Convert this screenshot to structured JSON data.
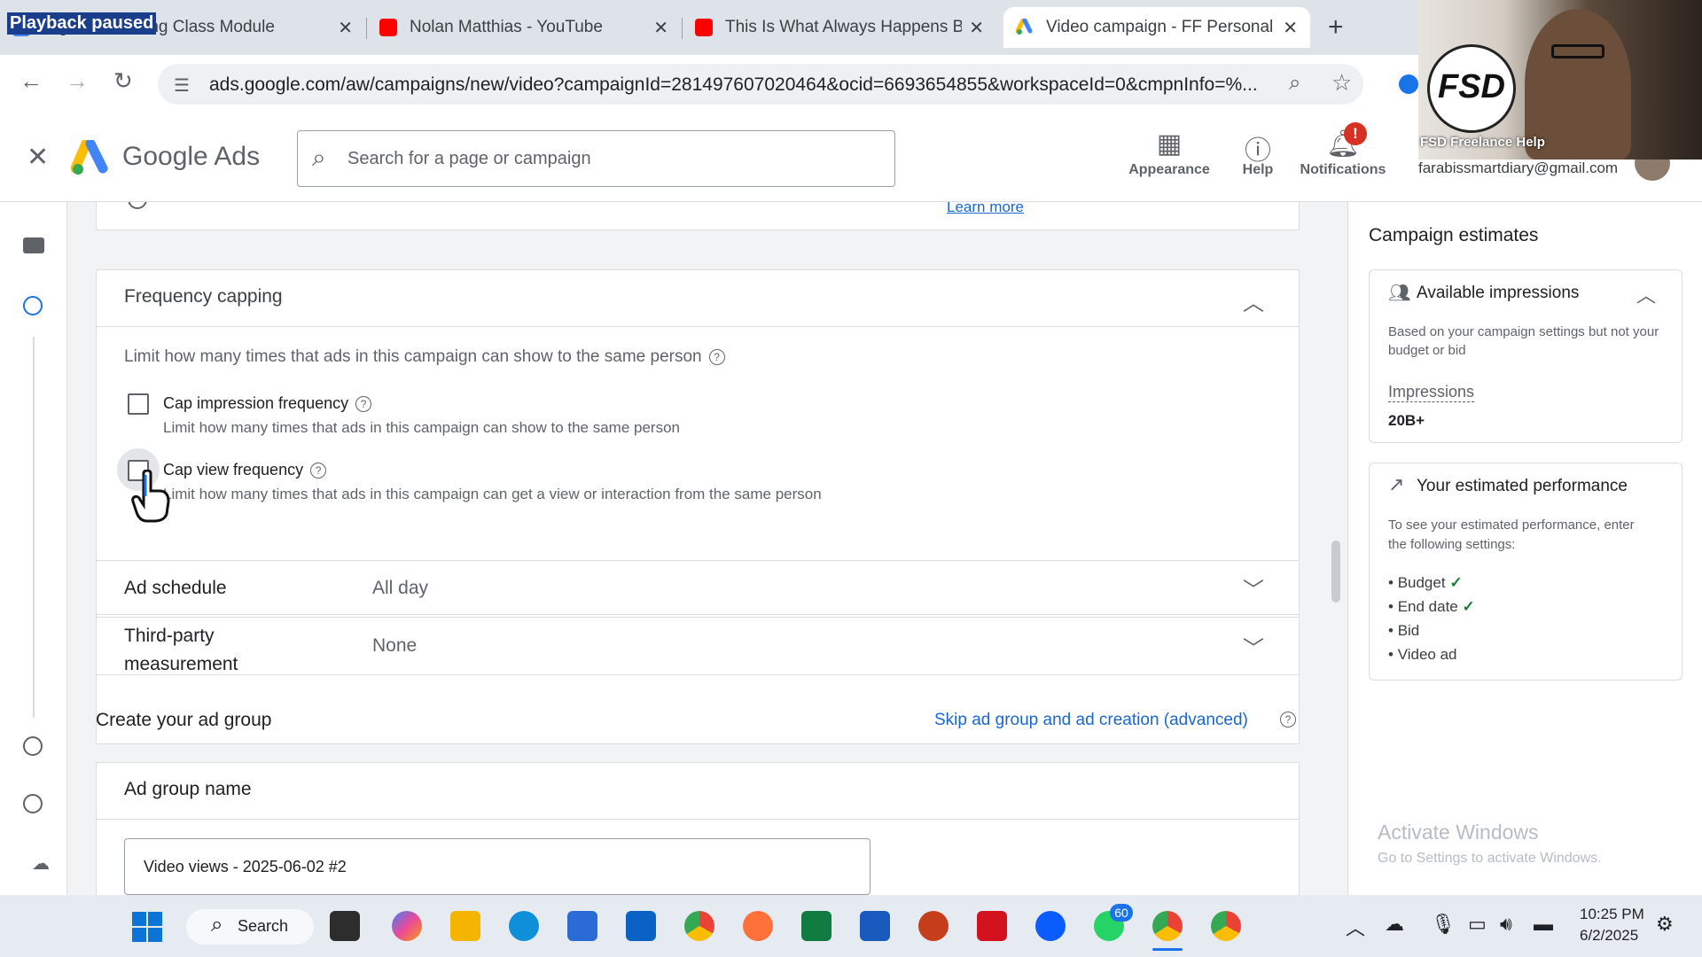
{
  "overlay": {
    "playback_text": "Playback paused"
  },
  "browser": {
    "tabs": [
      {
        "title": "Digital Marketing Class Module",
        "active": false
      },
      {
        "title": "Nolan Matthias - YouTube",
        "active": false
      },
      {
        "title": "This Is What Always Happens B",
        "active": false
      },
      {
        "title": "Video campaign - FF Personal -",
        "active": true
      }
    ],
    "url": "ads.google.com/aw/campaigns/new/video?campaignId=281497607020464&ocid=6693654855&workspaceId=0&cmpnInfo=%...",
    "new_tab": "+"
  },
  "ads_header": {
    "product": "Google Ads",
    "search_placeholder": "Search for a page or campaign",
    "appearance": "Appearance",
    "help": "Help",
    "notifications": "Notifications",
    "notification_badge": "!",
    "account": "farabissmartdiary@gmail.com"
  },
  "webcam": {
    "label": "FSD Freelance Help",
    "logo": "FSD"
  },
  "top_card": {
    "link": "Learn more"
  },
  "frequency": {
    "title": "Frequency capping",
    "description": "Limit how many times that ads in this campaign can show to the same person",
    "options": [
      {
        "label": "Cap impression frequency",
        "desc": "Limit how many times that ads in this campaign can show to the same person",
        "checked": false
      },
      {
        "label": "Cap view frequency",
        "desc": "Limit how many times that ads in this campaign can get a view or interaction from the same person",
        "checked": false
      }
    ]
  },
  "settings_rows": [
    {
      "label": "Ad schedule",
      "value": "All day"
    },
    {
      "label": "Third-party measurement",
      "value": "None"
    }
  ],
  "ad_group": {
    "section_title": "Create your ad group",
    "skip_link": "Skip ad group and ad creation (advanced)",
    "name_title": "Ad group name",
    "name_value": "Video views - 2025-06-02 #2"
  },
  "estimates": {
    "title": "Campaign estimates",
    "impressions_title": "Available impressions",
    "impressions_note": "Based on your campaign settings but not your budget or bid",
    "impressions_label": "Impressions",
    "impressions_value": "20B+",
    "performance_title": "Your estimated performance",
    "performance_note": "To see your estimated performance, enter the following settings:",
    "requirements": [
      {
        "label": "Budget",
        "done": true
      },
      {
        "label": "End date",
        "done": true
      },
      {
        "label": "Bid",
        "done": false
      },
      {
        "label": "Video ad",
        "done": false
      }
    ]
  },
  "watermark": {
    "title": "Activate Windows",
    "subtitle": "Go to Settings to activate Windows."
  },
  "taskbar": {
    "search": "Search",
    "whatsapp_badge": "60",
    "time": "10:25 PM",
    "date": "6/2/2025"
  },
  "colors": {
    "google_blue": "#1a73e8",
    "link": "#1967d2",
    "green_check": "#188038",
    "badge_red": "#d93025"
  }
}
